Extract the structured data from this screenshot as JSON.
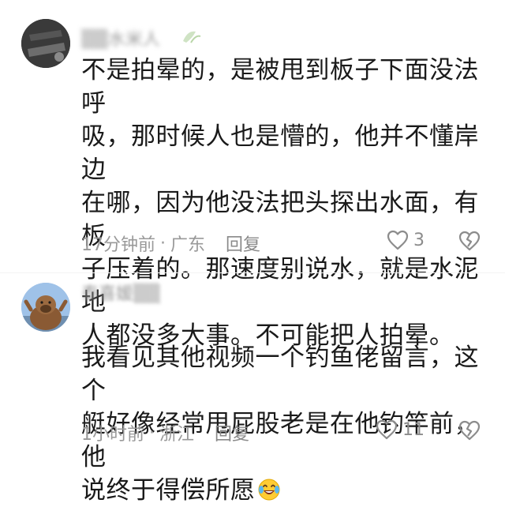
{
  "comments": [
    {
      "username": "▒▒水米人",
      "text": "不是拍晕的，是被甩到板子下面没法呼\n吸，那时候人也是懵的，他并不懂岸边\n在哪，因为他没法把头探出水面，有板\n子压着的。那速度别说水，就是水泥地\n人都没多大事。不可能把人拍晕。",
      "time": "17分钟前",
      "separator": "·",
      "location": "广东",
      "reply_label": "回复",
      "like_count": "3"
    },
    {
      "username": "泰喜媛▒▒",
      "text": "我看见其他视频一个钓鱼佬留言，这个\n艇好像经常甩屁股老是在他钓竿前，他\n说终于得偿所愿",
      "time": "1小时前",
      "separator": "·",
      "location": "浙江",
      "reply_label": "回复",
      "like_count": "11"
    }
  ],
  "icons": {
    "like": "heart-outline-icon",
    "dislike": "broken-heart-icon",
    "emoji": "laughing-tears-emoji"
  },
  "colors": {
    "text": "#1a1a1a",
    "meta": "#999999",
    "icon": "#8c8c8c"
  }
}
